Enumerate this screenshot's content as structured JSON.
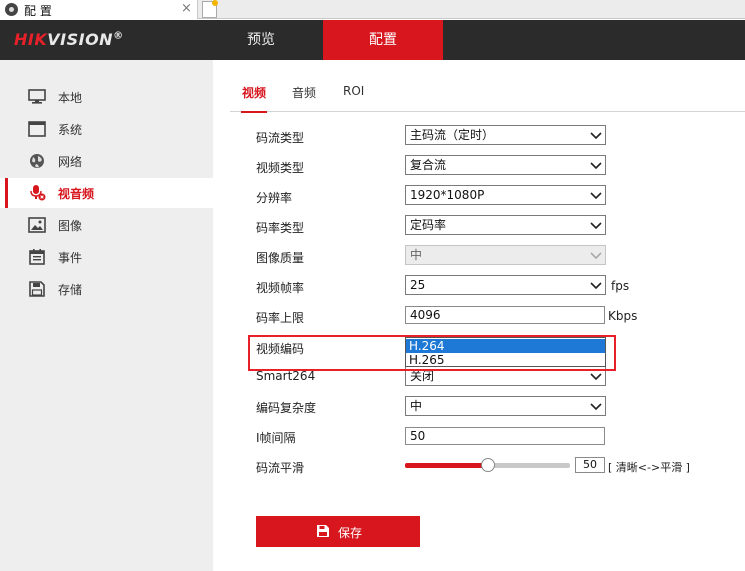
{
  "browser": {
    "tab_title": "配 置",
    "tab_close": "×"
  },
  "header": {
    "logo_red": "HIK",
    "logo_rest": "VISION",
    "logo_reg": "®",
    "nav": [
      {
        "label": "预览",
        "active": false
      },
      {
        "label": "配置",
        "active": true
      }
    ]
  },
  "sidebar": {
    "items": [
      {
        "label": "本地",
        "icon": "monitor-icon",
        "active": false
      },
      {
        "label": "系统",
        "icon": "system-window-icon",
        "active": false
      },
      {
        "label": "网络",
        "icon": "globe-icon",
        "active": false
      },
      {
        "label": "视音频",
        "icon": "microphone-icon",
        "active": true
      },
      {
        "label": "图像",
        "icon": "image-icon",
        "active": false
      },
      {
        "label": "事件",
        "icon": "calendar-icon",
        "active": false
      },
      {
        "label": "存储",
        "icon": "floppy-disk-icon",
        "active": false
      }
    ]
  },
  "subtabs": [
    {
      "label": "视频",
      "active": true
    },
    {
      "label": "音频",
      "active": false
    },
    {
      "label": "ROI",
      "active": false
    }
  ],
  "form": {
    "stream_type": {
      "label": "码流类型",
      "value": "主码流（定时）"
    },
    "video_type": {
      "label": "视频类型",
      "value": "复合流"
    },
    "resolution": {
      "label": "分辨率",
      "value": "1920*1080P"
    },
    "bitrate_type": {
      "label": "码率类型",
      "value": "定码率"
    },
    "image_quality": {
      "label": "图像质量",
      "value": "中"
    },
    "frame_rate": {
      "label": "视频帧率",
      "value": "25",
      "unit": "fps"
    },
    "max_bitrate": {
      "label": "码率上限",
      "value": "4096",
      "unit": "Kbps"
    },
    "video_encoding": {
      "label": "视频编码",
      "options": [
        "H.264",
        "H.265"
      ],
      "selected": "H.264"
    },
    "smart264": {
      "label": "Smart264",
      "value": "关闭"
    },
    "encoding_complexity": {
      "label": "编码复杂度",
      "value": "中"
    },
    "i_frame_interval": {
      "label": "I帧间隔",
      "value": "50"
    },
    "smoothing": {
      "label": "码流平滑",
      "value": "50",
      "hint": "[ 清晰<->平滑 ]",
      "level": 50
    }
  },
  "save_button": {
    "label": "保存"
  },
  "colors": {
    "accent": "#d7161e",
    "header_bg": "#2b2b2b",
    "sidebar_bg": "#eeeeee",
    "dropdown_selected": "#1e78d6"
  }
}
